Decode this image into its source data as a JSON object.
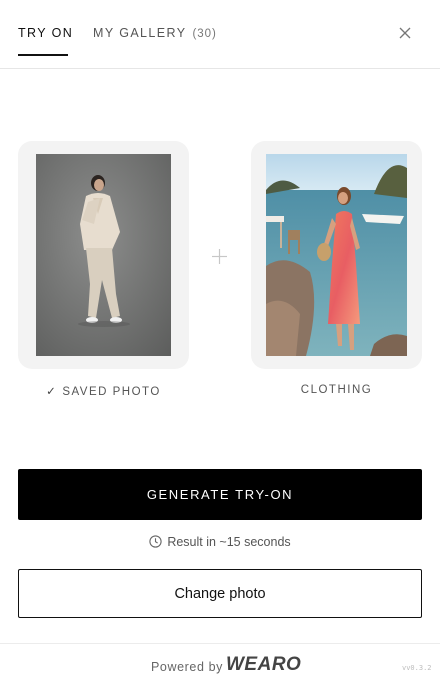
{
  "tabs": {
    "try_on": "TRY ON",
    "gallery": "MY GALLERY",
    "gallery_count": "(30)"
  },
  "saved_photo": {
    "caption_check": "✓",
    "caption": "SAVED PHOTO"
  },
  "clothing": {
    "caption": "CLOTHING"
  },
  "actions": {
    "generate": "GENERATE TRY-ON",
    "eta": "Result in ~15 seconds",
    "change_photo": "Change photo"
  },
  "footer": {
    "powered_by": "Powered by",
    "logo": "WEARO",
    "version": "vv0.3.2"
  },
  "colors": {
    "primary": "#000000",
    "card_bg": "#f3f3f3",
    "muted_text": "#555555"
  },
  "icons": {
    "close": "close-icon",
    "plus": "plus-icon",
    "clock": "clock-icon",
    "check": "check-icon"
  }
}
